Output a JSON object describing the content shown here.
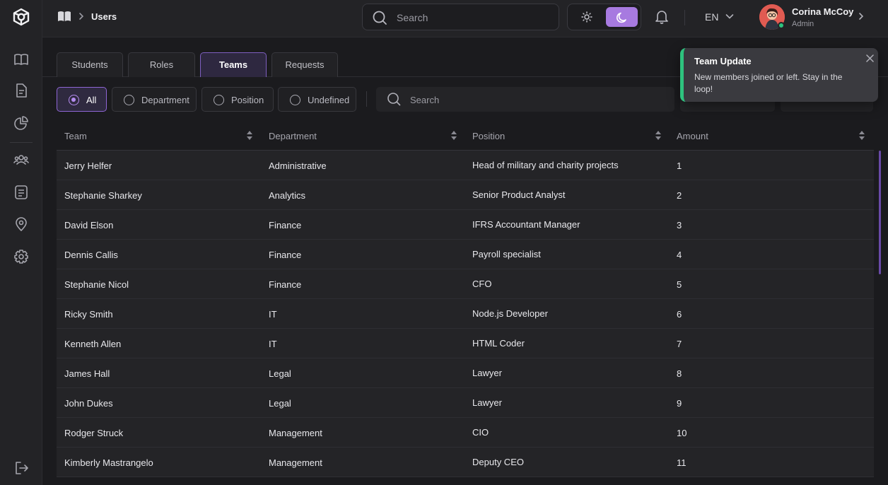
{
  "breadcrumb": {
    "current": "Users"
  },
  "search": {
    "placeholder": "Search"
  },
  "language": "EN",
  "user": {
    "name": "Corina McCoy",
    "role": "Admin"
  },
  "tabs": [
    {
      "label": "Students"
    },
    {
      "label": "Roles"
    },
    {
      "label": "Teams",
      "active": true
    },
    {
      "label": "Requests"
    }
  ],
  "filters": [
    {
      "label": "All",
      "active": true
    },
    {
      "label": "Department"
    },
    {
      "label": "Position"
    },
    {
      "label": "Undefined"
    }
  ],
  "table_search": {
    "placeholder": "Search"
  },
  "table": {
    "columns": [
      "Team",
      "Department",
      "Position",
      "Amount"
    ],
    "rows": [
      [
        "Jerry Helfer",
        "Administrative",
        "Head of military and charity projects",
        "1"
      ],
      [
        "Stephanie Sharkey",
        "Analytics",
        "Senior Product Analyst",
        "2"
      ],
      [
        "David Elson",
        "Finance",
        "IFRS Accountant Manager",
        "3"
      ],
      [
        "Dennis Callis",
        "Finance",
        "Payroll specialist",
        "4"
      ],
      [
        "Stephanie Nicol",
        "Finance",
        "CFO",
        "5"
      ],
      [
        "Ricky Smith",
        "IT",
        "Node.js Developer",
        "6"
      ],
      [
        "Kenneth Allen",
        "IT",
        "HTML Coder",
        "7"
      ],
      [
        "James Hall",
        "Legal",
        "Lawyer",
        "8"
      ],
      [
        "John Dukes",
        "Legal",
        "Lawyer",
        "9"
      ],
      [
        "Rodger Struck",
        "Management",
        "CIO",
        "10"
      ],
      [
        "Kimberly Mastrangelo",
        "Management",
        "Deputy CEO",
        "11"
      ]
    ]
  },
  "toast": {
    "title": "Team Update",
    "message": "New members joined or left. Stay in the loop!"
  },
  "colors": {
    "accent": "#a77ae0",
    "success": "#2ec27e",
    "background": "#1b1b1e"
  },
  "icons": [
    "logo-icon",
    "book-icon",
    "document-icon",
    "pie-chart-icon",
    "users-icon",
    "list-icon",
    "location-icon",
    "settings-icon",
    "logout-icon",
    "search-icon",
    "sun-icon",
    "moon-icon",
    "bell-icon",
    "chevron-down-icon",
    "chevron-right-icon",
    "sort-icon",
    "close-icon"
  ]
}
